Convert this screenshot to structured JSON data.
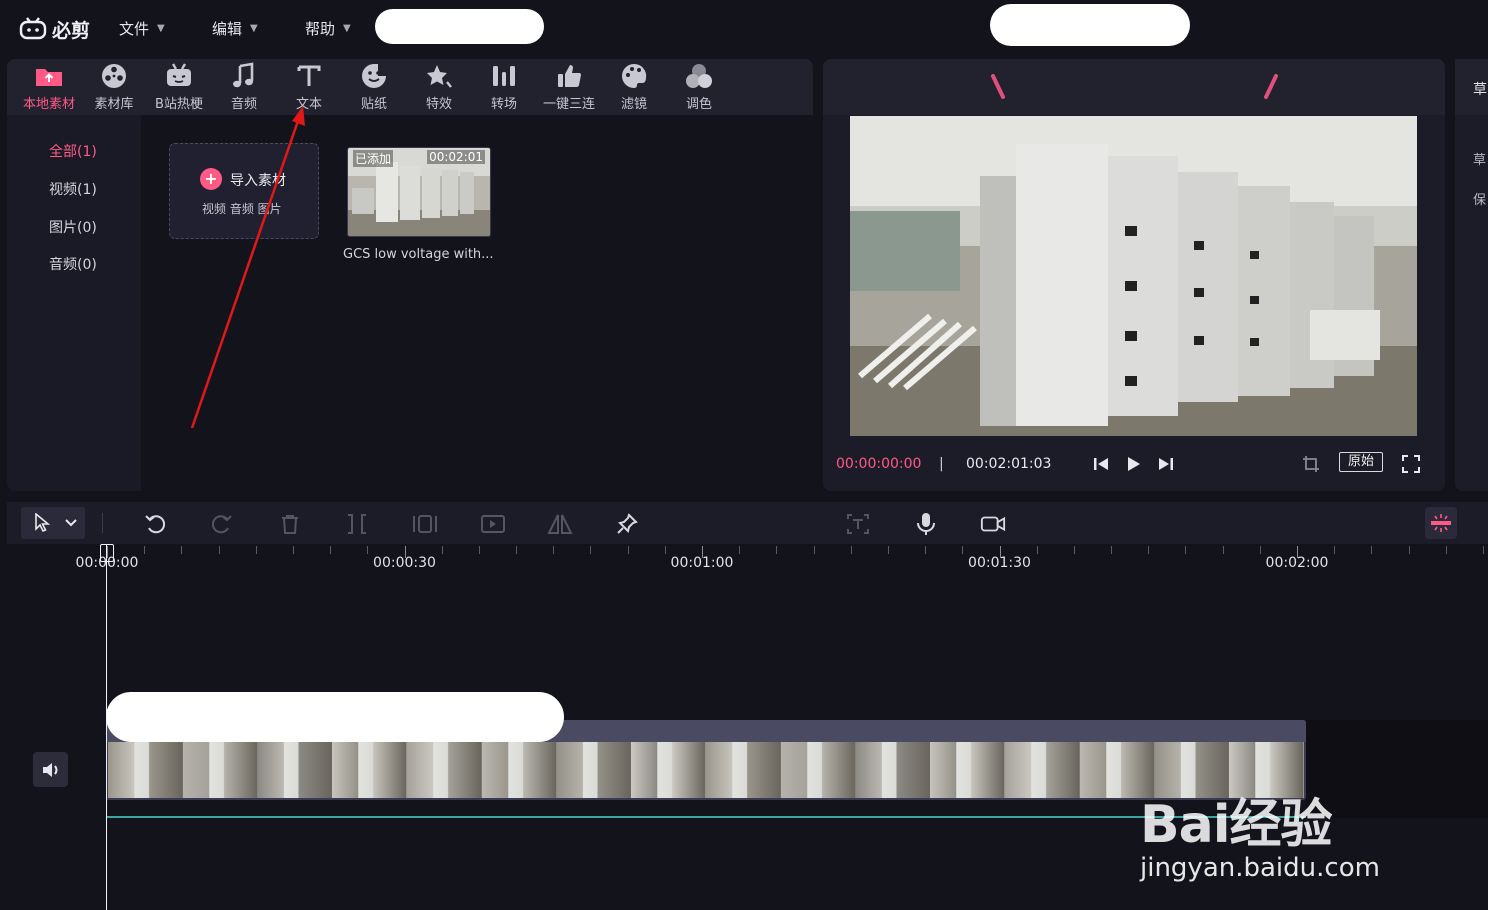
{
  "app": {
    "name": "必剪",
    "menus": [
      {
        "label": "文件"
      },
      {
        "label": "编辑"
      },
      {
        "label": "帮助"
      }
    ]
  },
  "tool_tabs": [
    {
      "label": "本地素材",
      "icon": "upload-folder-icon",
      "active": true
    },
    {
      "label": "素材库",
      "icon": "film-reel-icon"
    },
    {
      "label": "B站热梗",
      "icon": "bilibili-tv-icon"
    },
    {
      "label": "音频",
      "icon": "music-note-icon"
    },
    {
      "label": "文本",
      "icon": "text-t-icon"
    },
    {
      "label": "贴纸",
      "icon": "sticker-icon"
    },
    {
      "label": "特效",
      "icon": "star-effect-icon"
    },
    {
      "label": "转场",
      "icon": "transition-icon"
    },
    {
      "label": "一键三连",
      "icon": "thumbs-up-icon"
    },
    {
      "label": "滤镜",
      "icon": "palette-icon"
    },
    {
      "label": "调色",
      "icon": "color-circles-icon"
    }
  ],
  "side_list": [
    {
      "label": "全部(1)",
      "active": true
    },
    {
      "label": "视频(1)"
    },
    {
      "label": "图片(0)"
    },
    {
      "label": "音频(0)"
    }
  ],
  "import_card": {
    "title": "导入素材",
    "subtitle": "视频 音频 图片"
  },
  "media_item": {
    "badge": "已添加",
    "duration": "00:02:01",
    "name": "GCS low voltage with..."
  },
  "preview": {
    "current_time": "00:00:00:00",
    "separator": "|",
    "total_time": "00:02:01:03",
    "original_label": "原始"
  },
  "right_panel": {
    "head": "草",
    "items": [
      "草",
      "保"
    ]
  },
  "ruler": {
    "labels": [
      "00:00:00",
      "00:00:30",
      "00:01:00",
      "00:01:30",
      "00:02:00"
    ]
  },
  "watermark": {
    "brand": "Bai经验",
    "url": "jingyan.baidu.com"
  },
  "colors": {
    "accent": "#ff5a86",
    "annotation_arrow": "#e01818",
    "track_line": "#3fa5a0"
  }
}
